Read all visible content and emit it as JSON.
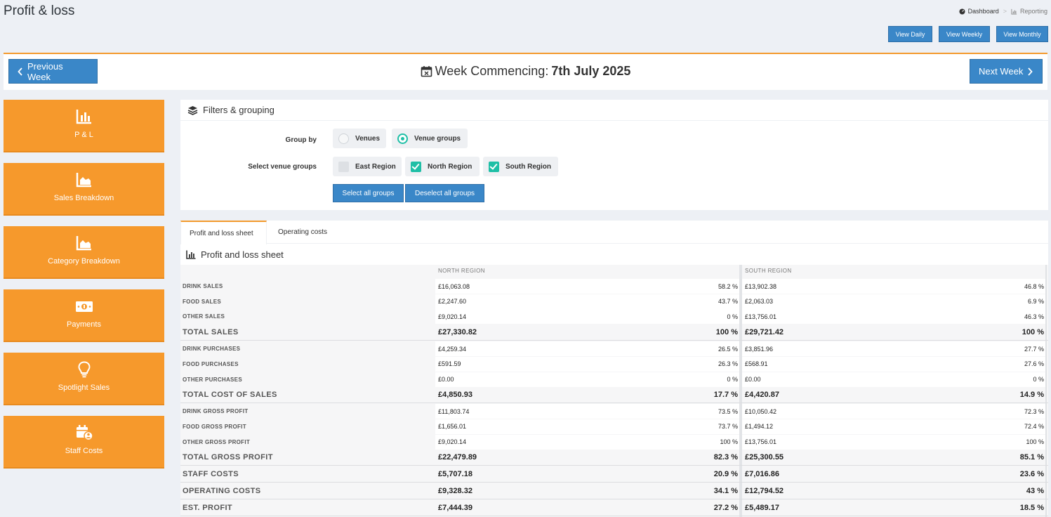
{
  "page": {
    "title": "Profit & loss"
  },
  "breadcrumb": {
    "home": "Dashboard",
    "current": "Reporting"
  },
  "view_buttons": [
    "View Daily",
    "View Weekly",
    "View Monthly"
  ],
  "week": {
    "prev_label": "Previous Week",
    "next_label": "Next Week",
    "prefix": "Week Commencing:",
    "date": "7th July 2025"
  },
  "sidebar": {
    "items": [
      {
        "label": "P & L",
        "icon": "bar-chart-icon"
      },
      {
        "label": "Sales Breakdown",
        "icon": "area-chart-icon"
      },
      {
        "label": "Category Breakdown",
        "icon": "area-chart-icon"
      },
      {
        "label": "Payments",
        "icon": "money-icon"
      },
      {
        "label": "Spotlight Sales",
        "icon": "lightbulb-icon"
      },
      {
        "label": "Staff Costs",
        "icon": "calendar-user-icon"
      }
    ]
  },
  "filters": {
    "title": "Filters & grouping",
    "group_by_label": "Group by",
    "group_by_options": [
      {
        "label": "Venues",
        "selected": false
      },
      {
        "label": "Venue groups",
        "selected": true
      }
    ],
    "venue_groups_label": "Select venue groups",
    "venue_groups": [
      {
        "label": "East Region",
        "checked": false
      },
      {
        "label": "North Region",
        "checked": true
      },
      {
        "label": "South Region",
        "checked": true
      }
    ],
    "select_all": "Select all groups",
    "deselect_all": "Deselect all groups"
  },
  "tabs": [
    "Profit and loss sheet",
    "Operating costs"
  ],
  "sheet": {
    "title": "Profit and loss sheet",
    "columns": [
      "NORTH REGION",
      "SOUTH REGION"
    ],
    "rows": [
      {
        "label": "DRINK SALES",
        "type": "small",
        "north": "£16,063.08",
        "north_pct": "58.2 %",
        "south": "£13,902.38",
        "south_pct": "46.8 %"
      },
      {
        "label": "FOOD SALES",
        "type": "small",
        "north": "£2,247.60",
        "north_pct": "43.7 %",
        "south": "£2,063.03",
        "south_pct": "6.9 %"
      },
      {
        "label": "OTHER SALES",
        "type": "small",
        "north": "£9,020.14",
        "north_pct": "0 %",
        "south": "£13,756.01",
        "south_pct": "46.3 %"
      },
      {
        "label": "TOTAL SALES",
        "type": "total",
        "north": "£27,330.82",
        "north_pct": "100 %",
        "south": "£29,721.42",
        "south_pct": "100 %"
      },
      {
        "label": "DRINK PURCHASES",
        "type": "small",
        "north": "£4,259.34",
        "north_pct": "26.5 %",
        "south": "£3,851.96",
        "south_pct": "27.7 %"
      },
      {
        "label": "FOOD PURCHASES",
        "type": "small",
        "north": "£591.59",
        "north_pct": "26.3 %",
        "south": "£568.91",
        "south_pct": "27.6 %"
      },
      {
        "label": "OTHER PURCHASES",
        "type": "small",
        "north": "£0.00",
        "north_pct": "0 %",
        "south": "£0.00",
        "south_pct": "0 %"
      },
      {
        "label": "TOTAL COST OF SALES",
        "type": "total",
        "north": "£4,850.93",
        "north_pct": "17.7 %",
        "south": "£4,420.87",
        "south_pct": "14.9 %"
      },
      {
        "label": "DRINK GROSS PROFIT",
        "type": "small",
        "north": "£11,803.74",
        "north_pct": "73.5 %",
        "south": "£10,050.42",
        "south_pct": "72.3 %"
      },
      {
        "label": "FOOD GROSS PROFIT",
        "type": "small",
        "north": "£1,656.01",
        "north_pct": "73.7 %",
        "south": "£1,494.12",
        "south_pct": "72.4 %"
      },
      {
        "label": "OTHER GROSS PROFIT",
        "type": "small",
        "north": "£9,020.14",
        "north_pct": "100 %",
        "south": "£13,756.01",
        "south_pct": "100 %"
      },
      {
        "label": "TOTAL GROSS PROFIT",
        "type": "total",
        "north": "£22,479.89",
        "north_pct": "82.3 %",
        "south": "£25,300.55",
        "south_pct": "85.1 %"
      },
      {
        "label": "STAFF COSTS",
        "type": "total",
        "north": "£5,707.18",
        "north_pct": "20.9 %",
        "south": "£7,016.86",
        "south_pct": "23.6 %"
      },
      {
        "label": "OPERATING COSTS",
        "type": "total",
        "north": "£9,328.32",
        "north_pct": "34.1 %",
        "south": "£12,794.52",
        "south_pct": "43 %"
      },
      {
        "label": "EST. PROFIT",
        "type": "total",
        "north": "£7,444.39",
        "north_pct": "27.2 %",
        "south": "£5,489.17",
        "south_pct": "18.5 %"
      }
    ]
  },
  "colors": {
    "accent": "#f6992c",
    "primary": "#3a87c8",
    "check": "#1fbfa6"
  }
}
